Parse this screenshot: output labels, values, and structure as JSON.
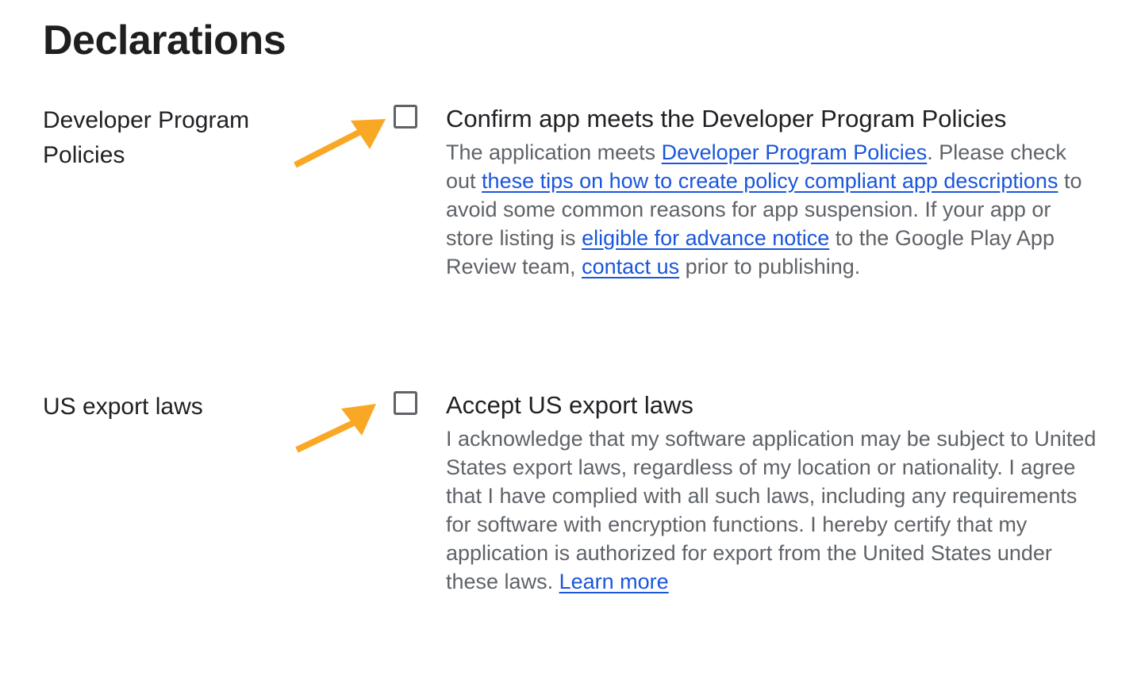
{
  "page": {
    "title": "Declarations"
  },
  "colors": {
    "arrow": "#F9A825",
    "link": "#1A56DB",
    "text": "#202124",
    "muted_text": "#5F6368",
    "checkbox_border": "#5F6368"
  },
  "sections": [
    {
      "label": "Developer Program Policies",
      "checkbox_checked": false,
      "option_title": "Confirm app meets the Developer Program Policies",
      "description": {
        "t1": "The application meets ",
        "link1": "Developer Program Policies",
        "t2": ". Please check out ",
        "link2": "these tips on how to create policy compliant app descriptions",
        "t3": " to avoid some common reasons for app suspension. If your app or store listing is ",
        "link3": "eligible for advance notice",
        "t4": " to the Google Play App Review team, ",
        "link4": "contact us",
        "t5": " prior to publishing."
      }
    },
    {
      "label": "US export laws",
      "checkbox_checked": false,
      "option_title": "Accept US export laws",
      "description": {
        "t1": "I acknowledge that my software application may be subject to United States export laws, regardless of my location or nationality. I agree that I have complied with all such laws, including any requirements for software with encryption functions. I hereby certify that my application is authorized for export from the United States under these laws. ",
        "link1": "Learn more"
      }
    }
  ]
}
